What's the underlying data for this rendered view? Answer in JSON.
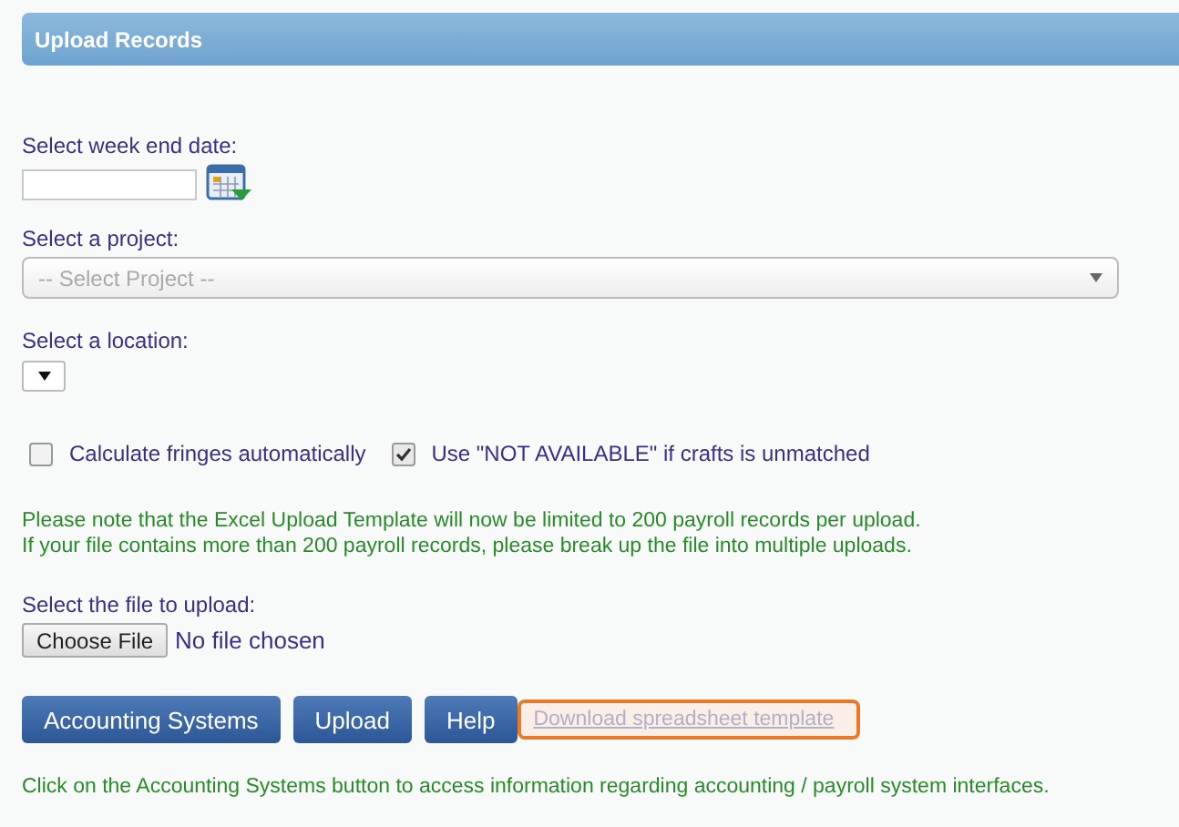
{
  "header": {
    "title": "Upload Records"
  },
  "week_end_date": {
    "label": "Select week end date:"
  },
  "project": {
    "label": "Select a project:",
    "placeholder": "-- Select Project --"
  },
  "location": {
    "label": "Select a location:"
  },
  "options": [
    {
      "label": "Calculate fringes automatically",
      "checked": false
    },
    {
      "label": "Use \"NOT AVAILABLE\" if crafts is unmatched",
      "checked": true
    }
  ],
  "notes": [
    "Please note that the Excel Upload Template will now be limited to 200 payroll records per upload.",
    "If your file contains more than 200 payroll records, please break up the file into multiple uploads."
  ],
  "file": {
    "label": "Select the file to upload:",
    "button": "Choose File",
    "status": "No file chosen"
  },
  "buttons": [
    "Accounting Systems",
    "Upload",
    "Help"
  ],
  "template_link": {
    "label": "Download spreadsheet template",
    "focused": true
  },
  "footer_note": "Click on the Accounting Systems button to access information regarding accounting / payroll system interfaces."
}
